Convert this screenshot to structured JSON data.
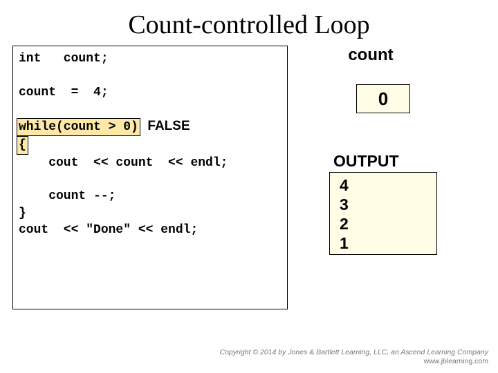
{
  "title": "Count-controlled Loop",
  "code": {
    "l1": "int   count;",
    "blank": " ",
    "l2": "count  =  4;",
    "l3a": "while(count > 0)",
    "l3false": "  FALSE",
    "l4": "{",
    "l5": "    cout  << count  << endl;",
    "l6": "    count --;",
    "l7": "}",
    "l8": "cout  << \"Done\" << endl;"
  },
  "var": {
    "label": "count",
    "value": "0"
  },
  "output": {
    "label": "OUTPUT",
    "lines": [
      "4",
      "3",
      "2",
      "1"
    ]
  },
  "footer": {
    "copyright": "Copyright © 2014 by Jones & Bartlett Learning, LLC, an Ascend Learning Company",
    "url": "www.jblearning.com"
  }
}
